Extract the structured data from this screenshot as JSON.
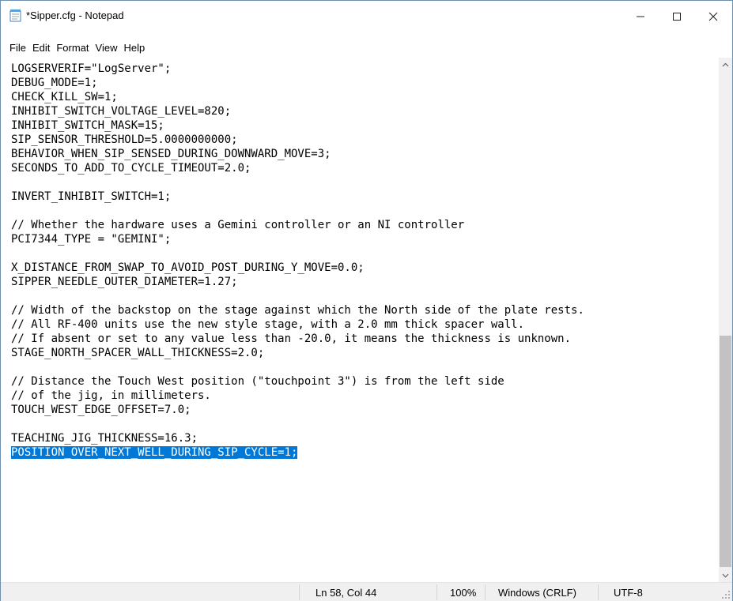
{
  "window": {
    "title": "*Sipper.cfg - Notepad",
    "icon": "notepad-icon",
    "buttons": {
      "minimize": "—",
      "maximize": "☐",
      "close": "✕"
    }
  },
  "menu": {
    "items": [
      "File",
      "Edit",
      "Format",
      "View",
      "Help"
    ]
  },
  "editor": {
    "lines": [
      "LOGSERVERIF=\"LogServer\";",
      "DEBUG_MODE=1;",
      "CHECK_KILL_SW=1;",
      "INHIBIT_SWITCH_VOLTAGE_LEVEL=820;",
      "INHIBIT_SWITCH_MASK=15;",
      "SIP_SENSOR_THRESHOLD=5.0000000000;",
      "BEHAVIOR_WHEN_SIP_SENSED_DURING_DOWNWARD_MOVE=3;",
      "SECONDS_TO_ADD_TO_CYCLE_TIMEOUT=2.0;",
      "",
      "INVERT_INHIBIT_SWITCH=1;",
      "",
      "// Whether the hardware uses a Gemini controller or an NI controller",
      "PCI7344_TYPE = \"GEMINI\";",
      "",
      "X_DISTANCE_FROM_SWAP_TO_AVOID_POST_DURING_Y_MOVE=0.0;",
      "SIPPER_NEEDLE_OUTER_DIAMETER=1.27;",
      "",
      "// Width of the backstop on the stage against which the North side of the plate rests.",
      "// All RF-400 units use the new style stage, with a 2.0 mm thick spacer wall.",
      "// If absent or set to any value less than -20.0, it means the thickness is unknown.",
      "STAGE_NORTH_SPACER_WALL_THICKNESS=2.0;",
      "",
      "// Distance the Touch West position (\"touchpoint 3\") is from the left side",
      "// of the jig, in millimeters.",
      "TOUCH_WEST_EDGE_OFFSET=7.0;",
      "",
      "TEACHING_JIG_THICKNESS=16.3;",
      "POSITION_OVER_NEXT_WELL_DURING_SIP_CYCLE=1;"
    ],
    "selected_line": "POSITION_OVER_NEXT_WELL_DURING_SIP_CYCLE=1;"
  },
  "status": {
    "position": "Ln 58, Col 44",
    "zoom": "100%",
    "line_ending": "Windows (CRLF)",
    "encoding": "UTF-8"
  },
  "colors": {
    "selection": "#0078d7",
    "statusbar": "#f0f0f0"
  }
}
